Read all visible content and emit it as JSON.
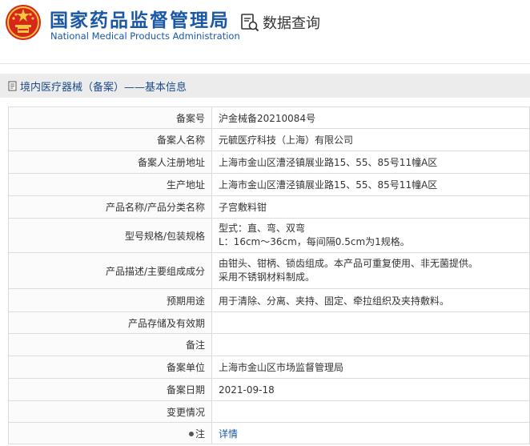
{
  "header": {
    "title_cn": "国家药品监督管理局",
    "title_en": "National Medical Products Administration",
    "search_label": "数据查询",
    "brand_color": "#1a57a6",
    "emblem_color": "#d7261b"
  },
  "breadcrumb": {
    "text": "境内医疗器械（备案）——基本信息"
  },
  "rows": [
    {
      "label": "备案号",
      "value": "沪金械备20210084号"
    },
    {
      "label": "备案人名称",
      "value": "元毓医疗科技（上海）有限公司"
    },
    {
      "label": "备案人注册地址",
      "value": "上海市金山区漕泾镇展业路15、55、85号11幢A区"
    },
    {
      "label": "生产地址",
      "value": "上海市金山区漕泾镇展业路15、55、85号11幢A区"
    },
    {
      "label": "产品名称/产品分类名称",
      "value": "子宫敷料钳"
    },
    {
      "label": "型号规格/包装规格",
      "value_lines": [
        "型式：直、弯、双弯",
        "L：16cm～36cm，每间隔0.5cm为1规格。"
      ]
    },
    {
      "label": "产品描述/主要组成成分",
      "value_lines": [
        "由钳头、钳柄、锁齿组成。本产品可重复使用、非无菌提供。",
        "采用不锈钢材料制成。"
      ]
    },
    {
      "label": "预期用途",
      "value": "用于清除、分离、夹持、固定、牵拉组织及夹持敷料。"
    },
    {
      "label": "产品存储及有效期",
      "value": ""
    },
    {
      "label": "备注",
      "value": ""
    },
    {
      "label": "备案单位",
      "value": "上海市金山区市场监督管理局"
    },
    {
      "label": "备案日期",
      "value": "2021-09-18"
    },
    {
      "label": "变更情况",
      "value": ""
    },
    {
      "label": "注",
      "value": "详情"
    }
  ]
}
